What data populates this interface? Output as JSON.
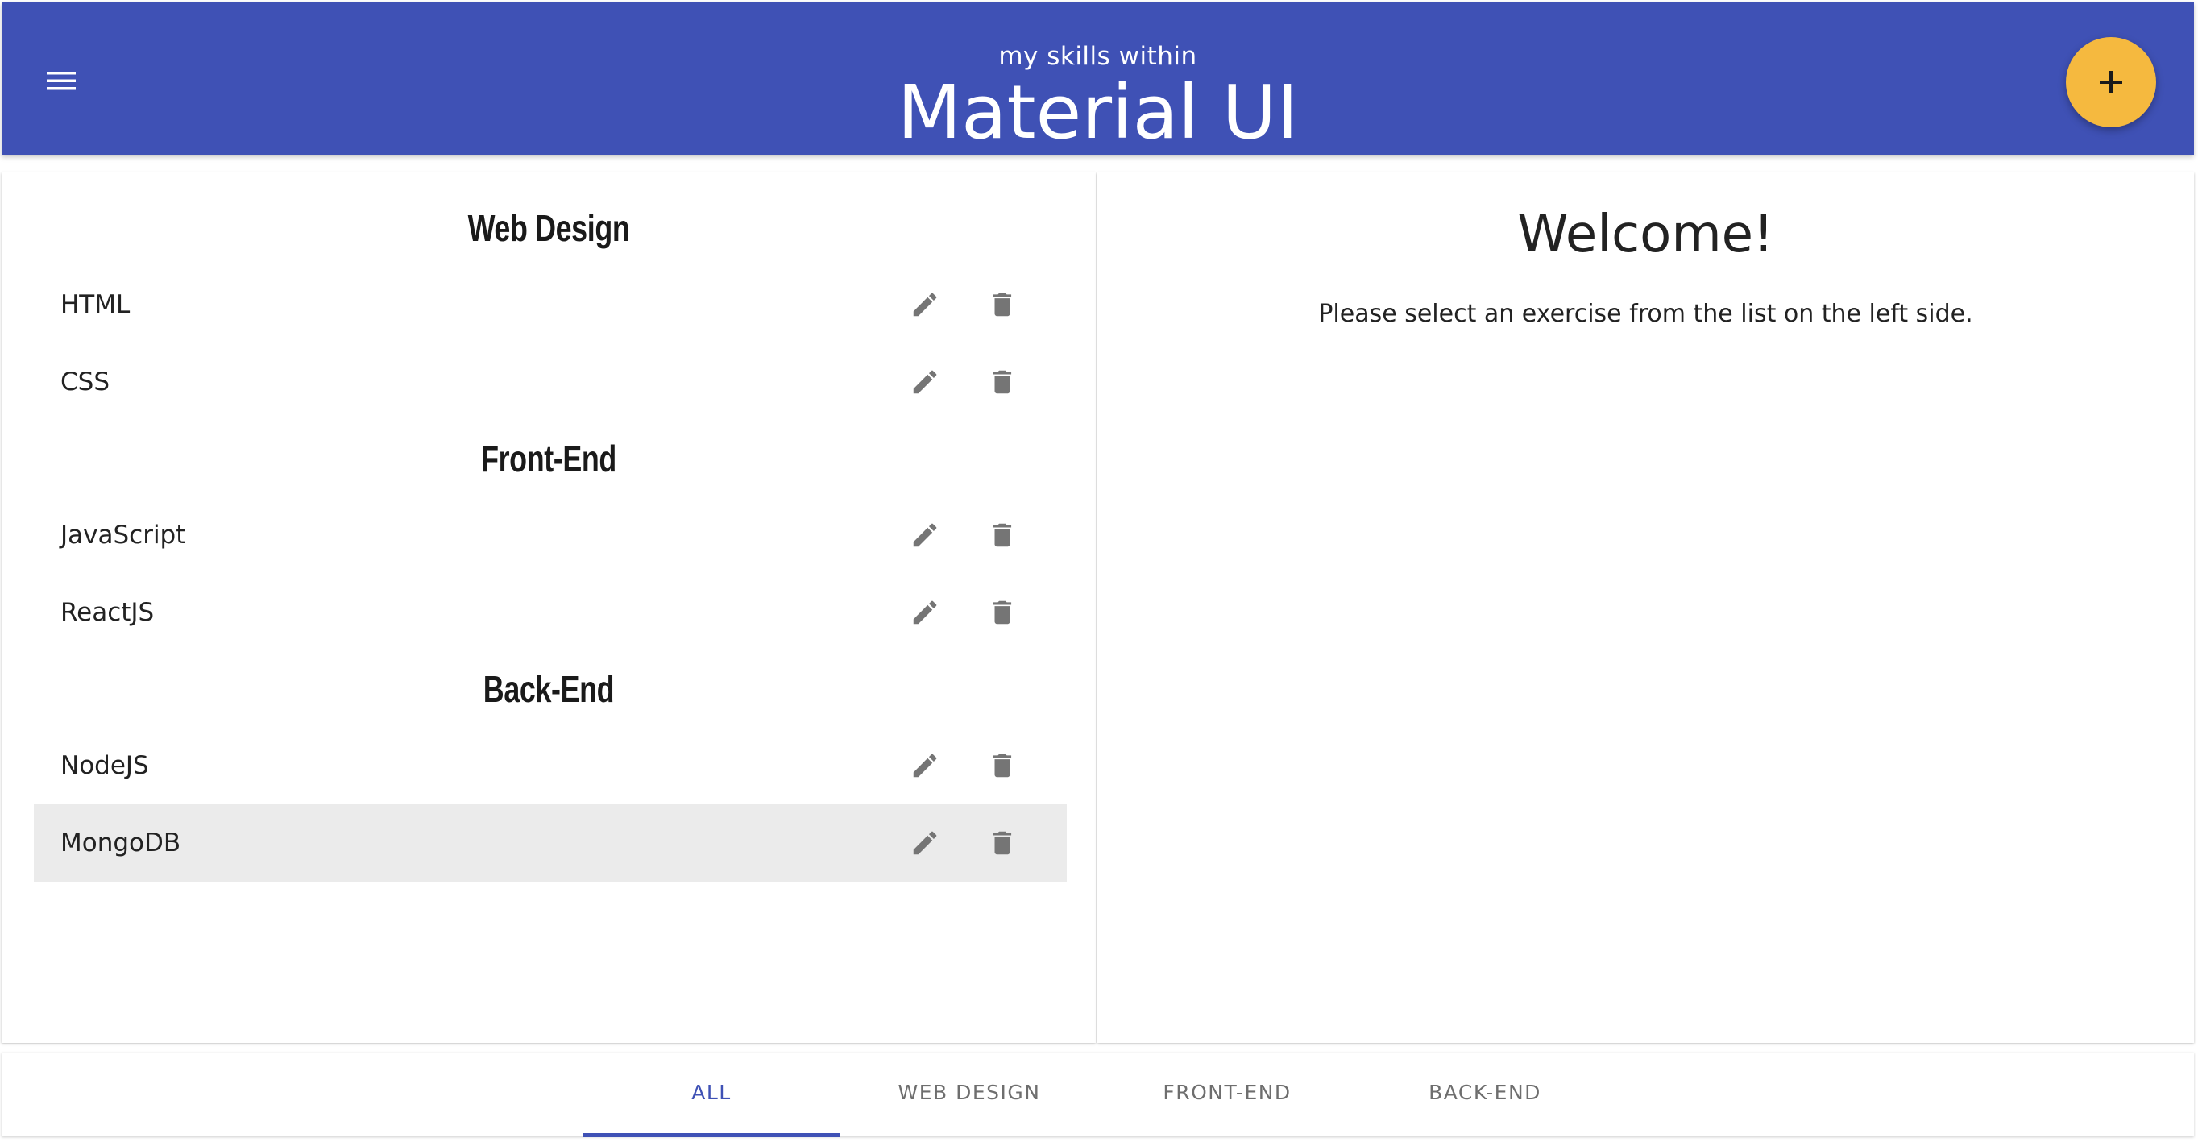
{
  "header": {
    "subtitle": "my skills within",
    "title": "Material UI",
    "menu_icon": "hamburger-menu-icon",
    "fab_icon": "plus-icon"
  },
  "groups": [
    {
      "title": "Web Design",
      "items": [
        {
          "label": "HTML"
        },
        {
          "label": "CSS"
        }
      ]
    },
    {
      "title": "Front-End",
      "items": [
        {
          "label": "JavaScript"
        },
        {
          "label": "ReactJS"
        }
      ]
    },
    {
      "title": "Back-End",
      "items": [
        {
          "label": "NodeJS"
        },
        {
          "label": "MongoDB",
          "selected": true
        }
      ]
    }
  ],
  "icons": {
    "edit": "pencil-icon",
    "delete": "trash-icon"
  },
  "detail": {
    "heading": "Welcome!",
    "message": "Please select an exercise from the list on the left side."
  },
  "tabs": [
    {
      "label": "ALL",
      "active": true
    },
    {
      "label": "WEB DESIGN"
    },
    {
      "label": "FRONT-END"
    },
    {
      "label": "BACK-END"
    }
  ],
  "colors": {
    "primary": "#3f51b5",
    "accent": "#f5b93f",
    "icon": "#757575",
    "selected_row": "#ebebeb"
  }
}
